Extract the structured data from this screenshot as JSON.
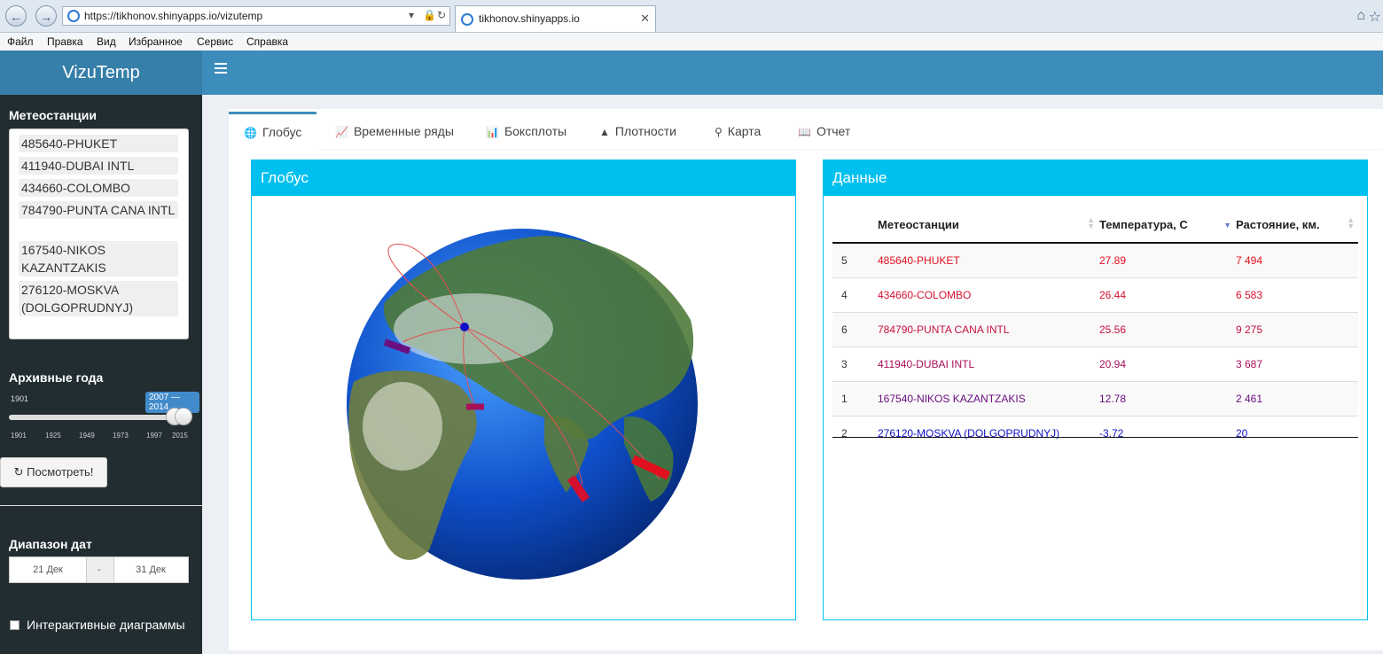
{
  "browser": {
    "url": "https://tikhonov.shinyapps.io/vizutemp",
    "tab_title": "tikhonov.shinyapps.io",
    "menu": [
      "Файл",
      "Правка",
      "Вид",
      "Избранное",
      "Сервис",
      "Справка"
    ]
  },
  "app": {
    "title": "VizuTemp"
  },
  "sidebar": {
    "stations_label": "Метеостанции",
    "stations": [
      "485640-PHUKET",
      "411940-DUBAI INTL",
      "434660-COLOMBO",
      "784790-PUNTA CANA INTL",
      "167540-NIKOS KAZANTZAKIS",
      "276120-MOSKVA (DOLGOPRUDNYJ)"
    ],
    "years_label": "Архивные года",
    "slider_min": "1901",
    "slider_value": "2007 — 2014",
    "slider_ticks": [
      "1901",
      "1925",
      "1949",
      "1973",
      "1997",
      "2015"
    ],
    "slider_from_fraction": 0.933,
    "slider_to_fraction": 0.986,
    "view_button": "Посмотреть!",
    "date_range_label": "Диапазон дат",
    "date_from": "21 Дек",
    "date_sep": "-",
    "date_to": "31 Дек",
    "interactive_label": "Интерактивные диаграммы"
  },
  "tabs": [
    {
      "label": "Глобус",
      "icon": "globe-icon",
      "active": true
    },
    {
      "label": "Временные ряды",
      "icon": "line-chart-icon",
      "active": false
    },
    {
      "label": "Боксплоты",
      "icon": "bar-chart-icon",
      "active": false
    },
    {
      "label": "Плотности",
      "icon": "area-chart-icon",
      "active": false
    },
    {
      "label": "Карта",
      "icon": "map-marker-icon",
      "active": false
    },
    {
      "label": "Отчет",
      "icon": "book-icon",
      "active": false
    }
  ],
  "globe_box": {
    "title": "Глобус"
  },
  "data_box": {
    "title": "Данные",
    "columns": [
      "",
      "Метеостанции",
      "Температура, C",
      "Растояние, км."
    ],
    "rows": [
      {
        "id": "5",
        "station": "485640-PHUKET",
        "temp": "27.89",
        "dist": "7 494",
        "color": "#e0101f"
      },
      {
        "id": "4",
        "station": "434660-COLOMBO",
        "temp": "26.44",
        "dist": "6 583",
        "color": "#d5102e"
      },
      {
        "id": "6",
        "station": "784790-PUNTA CANA INTL",
        "temp": "25.56",
        "dist": "9 275",
        "color": "#c8103d"
      },
      {
        "id": "3",
        "station": "411940-DUBAI INTL",
        "temp": "20.94",
        "dist": "3 687",
        "color": "#a8105a"
      },
      {
        "id": "1",
        "station": "167540-NIKOS KAZANTZAKIS",
        "temp": "12.78",
        "dist": "2 461",
        "color": "#6a1080"
      },
      {
        "id": "2",
        "station": "276120-MOSKVA (DOLGOPRUDNYJ)",
        "temp": "-3.72",
        "dist": "20",
        "color": "#1010c8"
      }
    ]
  },
  "colors": {
    "header": "#3c8dbc",
    "logo": "#367fa9",
    "sidebar": "#222d32",
    "box_accent": "#00c0ef"
  }
}
